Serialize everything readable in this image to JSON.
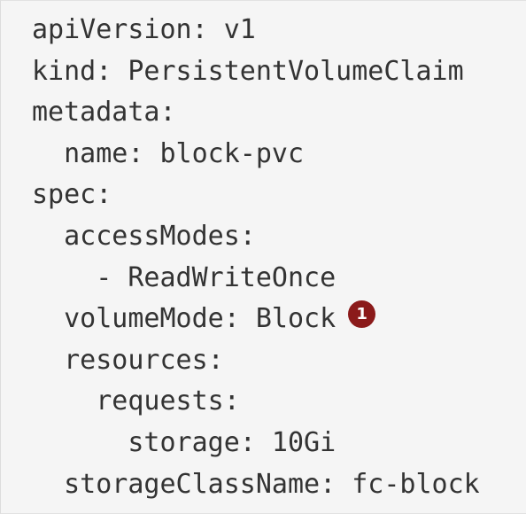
{
  "code": {
    "lines": [
      "apiVersion: v1",
      "kind: PersistentVolumeClaim",
      "metadata:",
      "  name: block-pvc",
      "spec:",
      "  accessModes:",
      "    - ReadWriteOnce",
      "  volumeMode: Block",
      "  resources:",
      "    requests:",
      "      storage: 10Gi",
      "  storageClassName: fc-block"
    ],
    "callout": {
      "number": "1",
      "color": "#8b1a1a"
    }
  }
}
